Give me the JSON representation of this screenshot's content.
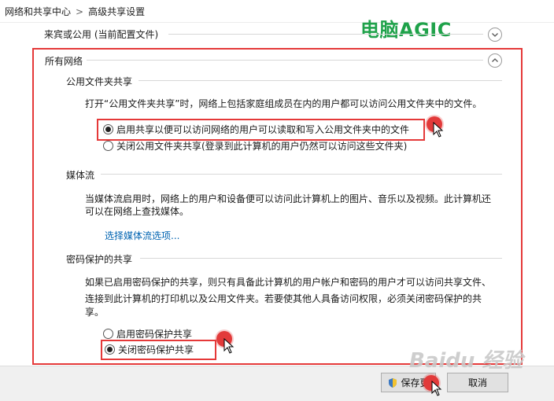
{
  "breadcrumb": {
    "item1": "网络和共享中心",
    "sep": ">",
    "item2": "高级共享设置"
  },
  "watermark_top": "电脑AGIC",
  "guest_public": {
    "title": "来宾或公用 (当前配置文件)"
  },
  "all_networks": {
    "title": "所有网络",
    "public_folder": {
      "title": "公用文件夹共享",
      "description": "打开“公用文件夹共享”时，网络上包括家庭组成员在内的用户都可以访问公用文件夹中的文件。",
      "option_on": "启用共享以便可以访问网络的用户可以读取和写入公用文件夹中的文件",
      "option_off": "关闭公用文件夹共享(登录到此计算机的用户仍然可以访问这些文件夹)"
    },
    "media": {
      "title": "媒体流",
      "desc_line1": "当媒体流启用时，网络上的用户和设备便可以访问此计算机上的图片、音乐以及视频。此计算机还",
      "desc_line2": "可以在网络上查找媒体。",
      "link": "选择媒体流选项..."
    },
    "password": {
      "title": "密码保护的共享",
      "desc_line1": "如果已启用密码保护的共享，则只有具备此计算机的用户帐户和密码的用户才可以访问共享文件、",
      "desc_line2": "连接到此计算机的打印机以及公用文件夹。若要使其他人具备访问权限，必须关闭密码保护的共",
      "desc_line3": "享。",
      "option_on": "启用密码保护共享",
      "option_off": "关闭密码保护共享"
    }
  },
  "buttons": {
    "save": "保存更",
    "cancel": "取消"
  },
  "watermark_bottom": "Baidu 经验",
  "colors": {
    "highlight": "#e53939",
    "link": "#0063b1",
    "brand_green": "#1fa24a"
  }
}
